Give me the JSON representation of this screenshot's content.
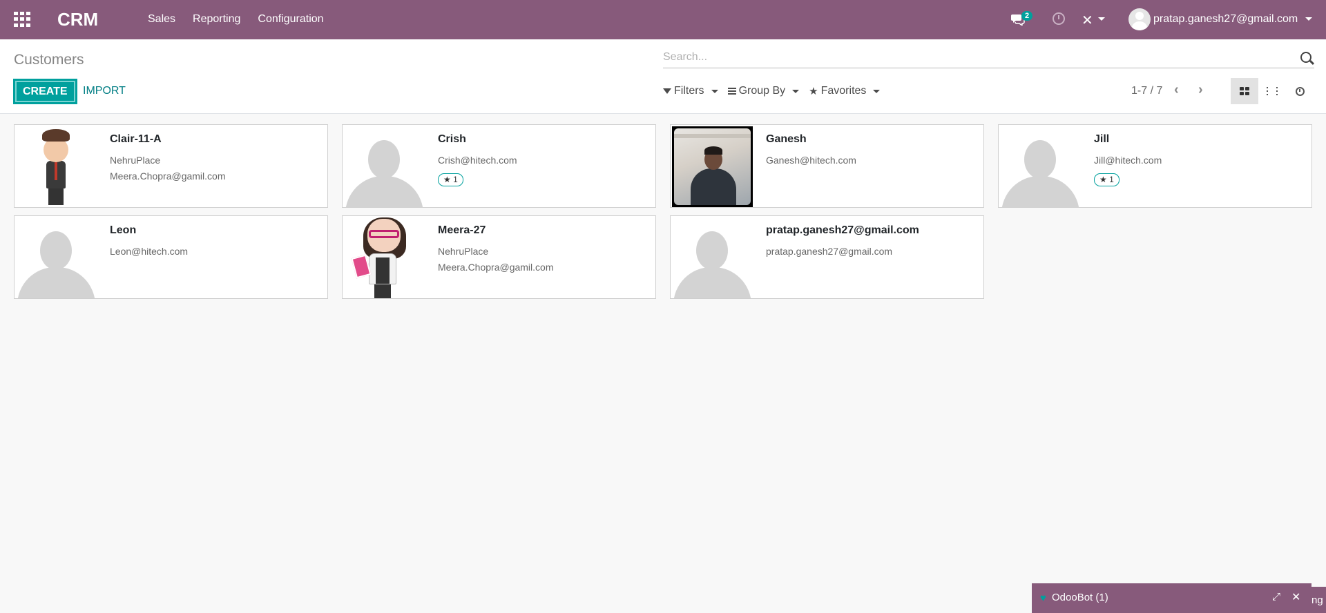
{
  "navbar": {
    "brand": "CRM",
    "menu": [
      "Sales",
      "Reporting",
      "Configuration"
    ],
    "chat_count": "2",
    "user_name": "pratap.ganesh27@gmail.com",
    "color": "#875a7b"
  },
  "control_panel": {
    "breadcrumb": "Customers",
    "search_placeholder": "Search...",
    "create_label": "CREATE",
    "import_label": "IMPORT",
    "filters_label": "Filters",
    "groupby_label": "Group By",
    "favorites_label": "Favorites",
    "pager": "1-7 / 7"
  },
  "cards": [
    {
      "name": "Clair-11-A",
      "line1": "NehruPlace",
      "line2": "Meera.Chopra@gamil.com",
      "tag": "",
      "image": "cartoon-businesswoman"
    },
    {
      "name": "Crish",
      "line1": "Crish@hitech.com",
      "line2": "",
      "tag": "1",
      "image": "placeholder-avatar"
    },
    {
      "name": "Ganesh",
      "line1": "Ganesh@hitech.com",
      "line2": "",
      "tag": "",
      "image": "photo"
    },
    {
      "name": "Jill",
      "line1": "Jill@hitech.com",
      "line2": "",
      "tag": "1",
      "image": "placeholder-avatar"
    },
    {
      "name": "Leon",
      "line1": "Leon@hitech.com",
      "line2": "",
      "tag": "",
      "image": "placeholder-avatar"
    },
    {
      "name": "Meera-27",
      "line1": "NehruPlace",
      "line2": "Meera.Chopra@gamil.com",
      "tag": "",
      "image": "cartoon-woman-glasses"
    },
    {
      "name": "pratap.ganesh27@gmail.com",
      "line1": "pratap.ganesh27@gmail.com",
      "line2": "",
      "tag": "",
      "image": "placeholder-avatar"
    }
  ],
  "chat": {
    "title": "OdooBot (1)",
    "tail_text": "ng"
  },
  "colors": {
    "accent": "#00a09d",
    "navbar": "#875a7b"
  }
}
